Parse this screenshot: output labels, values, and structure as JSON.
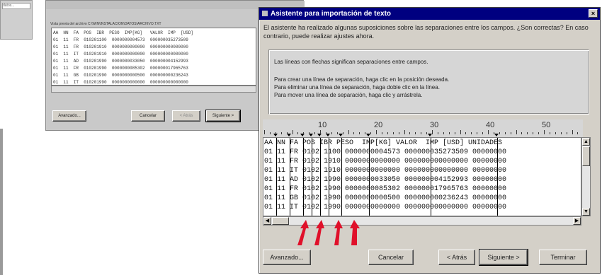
{
  "left_fragment": {
    "text": "datos..."
  },
  "back_dialog": {
    "header_text": "Vista previa del archivo C:\\WIN\\INSTALACION\\DATOS\\ARCHIVO.TXT",
    "rows": [
      "AA  NN  FA  POS  IBR  PESO  IMP[KG]   VALOR  IMP  [USD]",
      "01  11  FR  010201100  0000000004573  000000035273509",
      "01  11  FR  010201910  0000000000000  000000000000000",
      "01  11  IT  010201910  0000000000000  000000000000000",
      "01  11  AD  010201990  0000000033050  000000004152993",
      "01  11  FR  010201990  0000000085302  000000017965763",
      "01  11  GB  010201990  0000000000500  000000000236243",
      "01  11  IT  010201990  0000000000000  000000000000000"
    ],
    "buttons": {
      "advanced": "Avanzado...",
      "cancel": "Cancelar",
      "back": "< Atrás",
      "next": "Siguiente >"
    }
  },
  "main_dialog": {
    "title": "Asistente para importación de texto",
    "close": "×",
    "intro": "El asistente ha realizado algunas suposiciones sobre las separaciones entre los campos. ¿Son correctas? En caso contrario, puede realizar ajustes ahora.",
    "info_lines": [
      "Las líneas con flechas significan separaciones entre campos.",
      "Para crear una línea de separación, haga clic en la posición deseada.",
      "Para eliminar una línea de separación, haga doble clic en la línea.",
      "Para mover una línea de separación, haga clic y arrástrela."
    ],
    "ruler_numbers": [
      "10",
      "20",
      "30",
      "40",
      "50"
    ],
    "rows": [
      "AA NN FA POS IBR PESO  IMP[KG] VALOR  IMP [USD] UNIDADES",
      "01 11 FR 0102 1100 0000000004573 000000035273509 00000000",
      "01 11 FR 0102 1910 0000000000000 000000000000000 00000000",
      "01 11 IT 0102 1910 0000000000000 000000000000000 00000000",
      "01 11 AD 0102 1990 0000000033050 000000004152993 00000000",
      "01 11 FR 0102 1990 0000000085302 000000017965763 00000000",
      "01 11 GB 0102 1990 0000000000500 000000000236243 00000000",
      "01 11 IT 0102 1990 0000000000000 000000000000000 00000000"
    ],
    "buttons": {
      "advanced": "Avanzado...",
      "cancel": "Cancelar",
      "back": "< Atrás",
      "next": "Siguiente >",
      "finish": "Terminar"
    },
    "colors": {
      "title_bar": "#000080",
      "arrow": "#e0102a",
      "dialog_bg": "#d4d0c8"
    }
  },
  "annotation": {
    "icon": "red-arrow-icon",
    "count": 4
  }
}
